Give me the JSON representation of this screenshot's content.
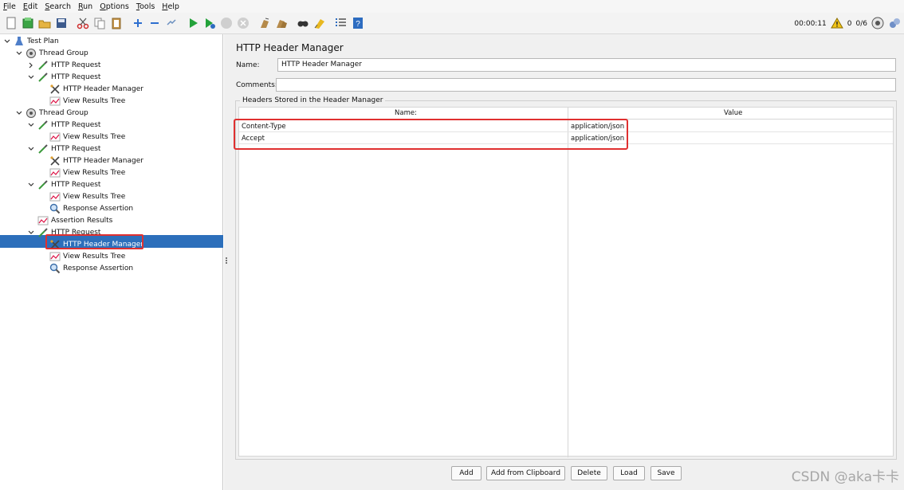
{
  "menu": {
    "items": [
      {
        "label": "File",
        "u": "F",
        "rest": "ile"
      },
      {
        "label": "Edit",
        "u": "E",
        "rest": "dit"
      },
      {
        "label": "Search",
        "u": "S",
        "rest": "earch"
      },
      {
        "label": "Run",
        "u": "R",
        "rest": "un"
      },
      {
        "label": "Options",
        "u": "O",
        "rest": "ptions"
      },
      {
        "label": "Tools",
        "u": "T",
        "rest": "ools"
      },
      {
        "label": "Help",
        "u": "H",
        "rest": "elp"
      }
    ]
  },
  "toolbar": {
    "timer": "00:00:11",
    "warning_count": "0",
    "threads": "0/6"
  },
  "tree": {
    "nodes": [
      {
        "label": "Test Plan",
        "icon": "test-plan-icon",
        "expander": "v"
      },
      {
        "label": "Thread Group",
        "icon": "gear-icon",
        "expander": "v"
      },
      {
        "label": "HTTP Request",
        "icon": "pipette-icon",
        "expander": ">"
      },
      {
        "label": "HTTP Request",
        "icon": "pipette-icon",
        "expander": "v"
      },
      {
        "label": "HTTP Header Manager",
        "icon": "tools-icon",
        "expander": ""
      },
      {
        "label": "View Results Tree",
        "icon": "chart-icon",
        "expander": ""
      },
      {
        "label": "Thread Group",
        "icon": "gear-icon",
        "expander": "v"
      },
      {
        "label": "HTTP Request",
        "icon": "pipette-icon",
        "expander": "v"
      },
      {
        "label": "View Results Tree",
        "icon": "chart-icon",
        "expander": ""
      },
      {
        "label": "HTTP Request",
        "icon": "pipette-icon",
        "expander": "v"
      },
      {
        "label": "HTTP Header Manager",
        "icon": "tools-icon",
        "expander": ""
      },
      {
        "label": "View Results Tree",
        "icon": "chart-icon",
        "expander": ""
      },
      {
        "label": "HTTP Request",
        "icon": "pipette-icon",
        "expander": "v"
      },
      {
        "label": "View Results Tree",
        "icon": "chart-icon",
        "expander": ""
      },
      {
        "label": "Response Assertion",
        "icon": "magnifier-icon",
        "expander": ""
      },
      {
        "label": "Assertion Results",
        "icon": "chart-icon",
        "expander": ""
      },
      {
        "label": "HTTP Request",
        "icon": "pipette-icon",
        "expander": "v"
      },
      {
        "label": "HTTP Header Manager",
        "icon": "tools-icon",
        "expander": "",
        "selected": true
      },
      {
        "label": "View Results Tree",
        "icon": "chart-icon",
        "expander": ""
      },
      {
        "label": "Response Assertion",
        "icon": "magnifier-icon",
        "expander": ""
      }
    ]
  },
  "panel": {
    "title": "HTTP Header Manager",
    "name_label": "Name:",
    "name_value": "HTTP Header Manager",
    "comments_label": "Comments:",
    "comments_value": "",
    "group_title": "Headers Stored in the Header Manager",
    "columns": {
      "name": "Name:",
      "value": "Value"
    },
    "headers": [
      {
        "name": "Content-Type",
        "value": "application/json"
      },
      {
        "name": "Accept",
        "value": "application/json"
      }
    ],
    "buttons": {
      "add": "Add",
      "add_clipboard": "Add from Clipboard",
      "delete": "Delete",
      "load": "Load",
      "save": "Save"
    }
  },
  "watermark": "CSDN @aka卡卡",
  "colors": {
    "selection": "#2c6fbb",
    "highlight_box": "#e03030"
  }
}
